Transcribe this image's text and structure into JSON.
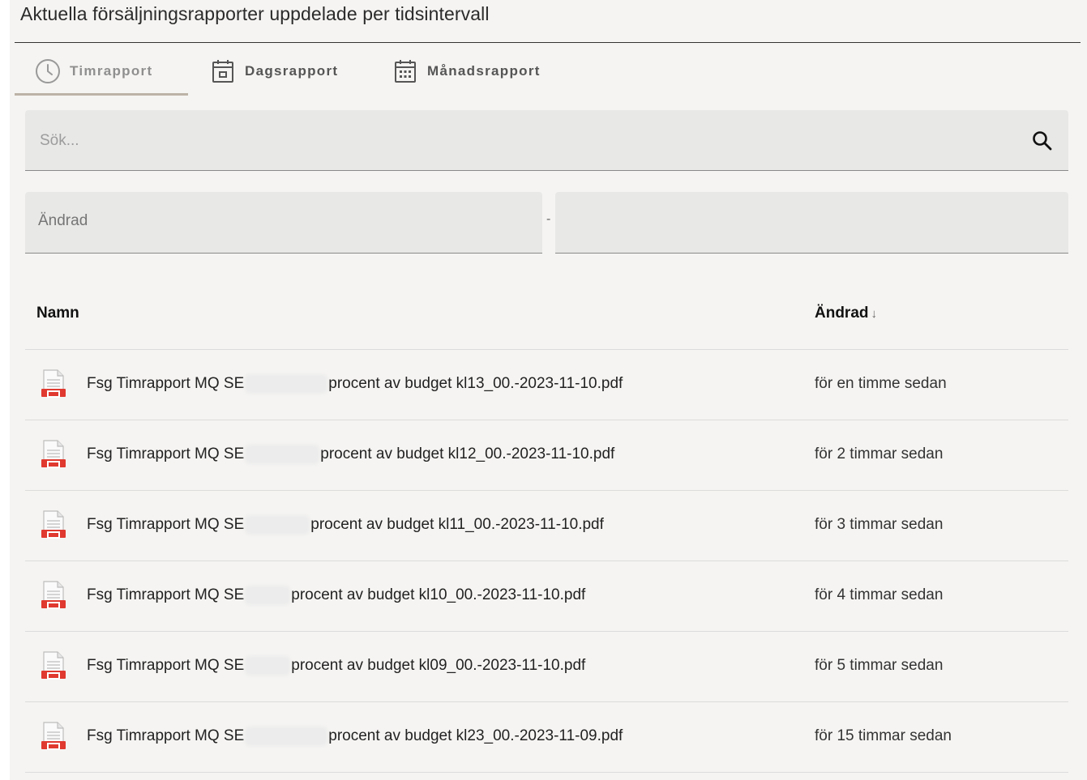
{
  "title": "Aktuella försäljningsrapporter uppdelade per tidsintervall",
  "tabs": [
    {
      "label": "Timrapport",
      "icon": "clock-icon",
      "active": true
    },
    {
      "label": "Dagsrapport",
      "icon": "calendar-day-icon",
      "active": false
    },
    {
      "label": "Månadsrapport",
      "icon": "calendar-month-icon",
      "active": false
    }
  ],
  "search": {
    "placeholder": "Sök...",
    "value": ""
  },
  "filter": {
    "from_label": "Ändrad",
    "separator": "-",
    "to_label": ""
  },
  "table": {
    "columns": {
      "name": "Namn",
      "modified": "Ändrad",
      "sort_indicator": "↓"
    },
    "rows": [
      {
        "prefix": "Fsg Timrapport MQ SE",
        "suffix": "procent av budget kl13_00.-2023-11-10.pdf",
        "modified": "för en timme sedan"
      },
      {
        "prefix": "Fsg Timrapport MQ SE",
        "suffix": "procent av budget kl12_00.-2023-11-10.pdf",
        "modified": "för 2 timmar sedan"
      },
      {
        "prefix": "Fsg Timrapport MQ SE",
        "suffix": "procent av budget kl11_00.-2023-11-10.pdf",
        "modified": "för 3 timmar sedan"
      },
      {
        "prefix": "Fsg Timrapport MQ SE",
        "suffix": "procent av budget kl10_00.-2023-11-10.pdf",
        "modified": "för 4 timmar sedan"
      },
      {
        "prefix": "Fsg Timrapport MQ SE",
        "suffix": "procent av budget kl09_00.-2023-11-10.pdf",
        "modified": "för 5 timmar sedan"
      },
      {
        "prefix": "Fsg Timrapport MQ SE",
        "suffix": "procent av budget kl23_00.-2023-11-09.pdf",
        "modified": "för 15 timmar sedan"
      }
    ]
  },
  "colors": {
    "background": "#f5f4f2",
    "field": "#e8e8e7",
    "tab_indicator": "#bdb3a7",
    "pdf_red": "#e0392f"
  }
}
